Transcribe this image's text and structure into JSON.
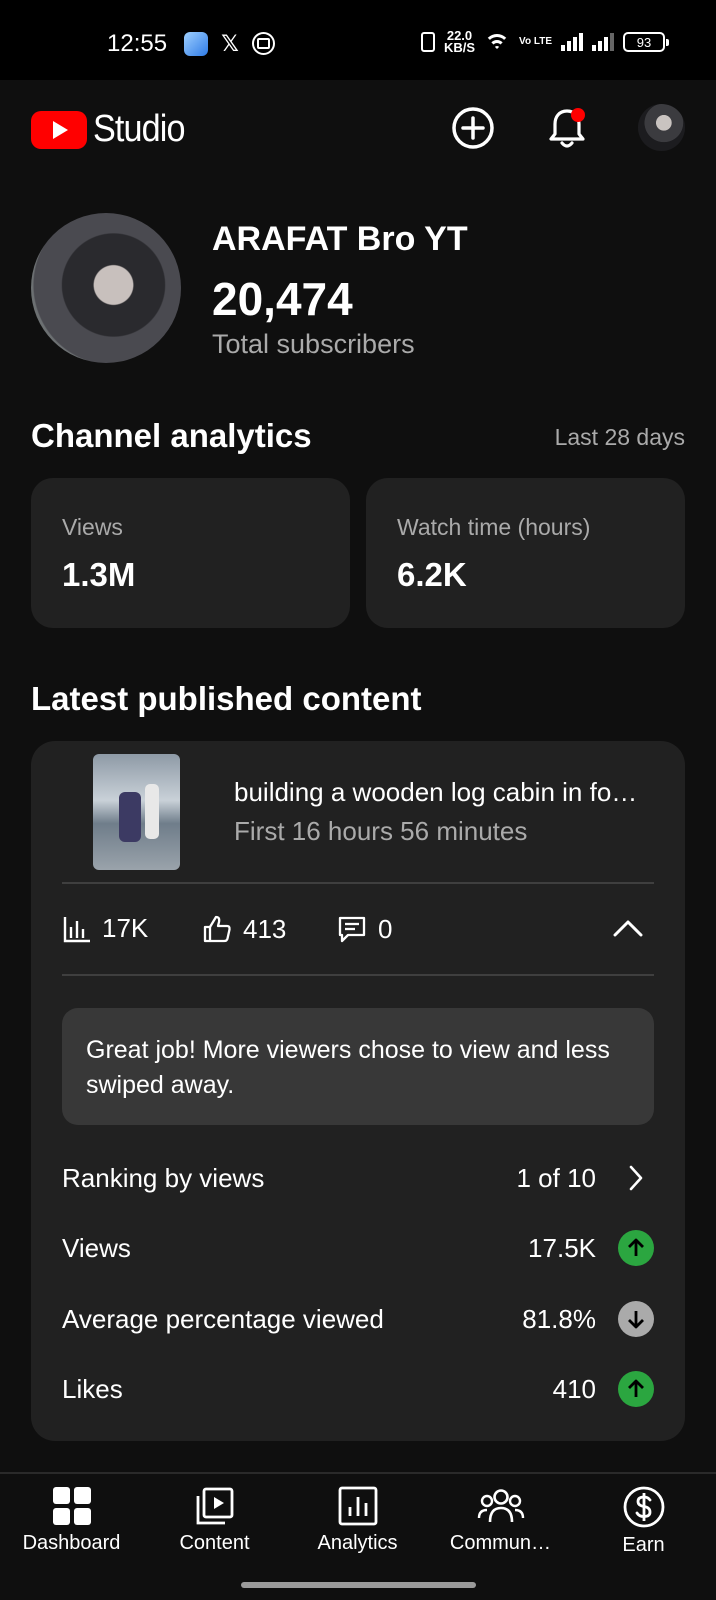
{
  "status_bar": {
    "time": "12:55",
    "net_speed_value": "22.0",
    "net_speed_unit": "KB/S",
    "volte": "Vo LTE",
    "battery": "93"
  },
  "app": {
    "logo_text": "Studio",
    "brand_color": "#ff0000"
  },
  "channel": {
    "name": "ARAFAT Bro YT",
    "subscribers": "20,474",
    "subscribers_label": "Total subscribers"
  },
  "analytics": {
    "title": "Channel analytics",
    "period": "Last 28 days",
    "metrics": [
      {
        "label": "Views",
        "value": "1.3M"
      },
      {
        "label": "Watch time (hours)",
        "value": "6.2K"
      }
    ]
  },
  "latest": {
    "title": "Latest published content",
    "video_title": "building a wooden log cabin in fo…",
    "video_subtitle": "First 16 hours 56 minutes",
    "stats": {
      "views": "17K",
      "likes": "413",
      "comments": "0"
    },
    "tip": "Great job! More viewers chose to view and less swiped away.",
    "rows": [
      {
        "label": "Ranking by views",
        "value": "1 of 10",
        "indicator": "chevron-right"
      },
      {
        "label": "Views",
        "value": "17.5K",
        "indicator": "arrow-up"
      },
      {
        "label": "Average percentage viewed",
        "value": "81.8%",
        "indicator": "arrow-down"
      },
      {
        "label": "Likes",
        "value": "410",
        "indicator": "arrow-up"
      }
    ],
    "up_color": "#2ba640",
    "down_color": "#aaaaaa"
  },
  "bottom_nav": [
    {
      "label": "Dashboard",
      "icon": "dashboard-icon"
    },
    {
      "label": "Content",
      "icon": "content-icon"
    },
    {
      "label": "Analytics",
      "icon": "analytics-icon"
    },
    {
      "label": "Commun…",
      "icon": "community-icon"
    },
    {
      "label": "Earn",
      "icon": "earn-icon"
    }
  ]
}
